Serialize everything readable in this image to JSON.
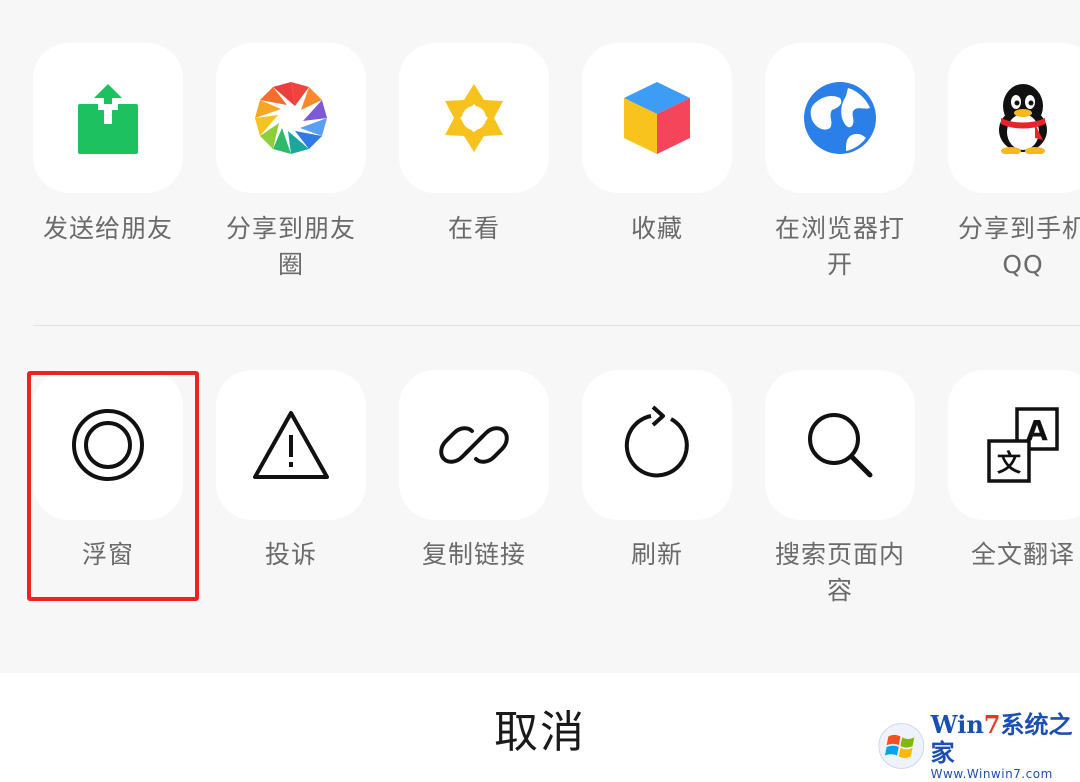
{
  "share_row": [
    {
      "label": "发送给朋友",
      "icon": "share-out-icon"
    },
    {
      "label": "分享到朋友圈",
      "icon": "moments-aperture-icon"
    },
    {
      "label": "在看",
      "icon": "wow-star-icon"
    },
    {
      "label": "收藏",
      "icon": "favorite-cube-icon"
    },
    {
      "label": "在浏览器打开",
      "icon": "globe-icon"
    },
    {
      "label": "分享到手机QQ",
      "icon": "qq-penguin-icon"
    }
  ],
  "action_row": [
    {
      "label": "浮窗",
      "icon": "float-window-icon"
    },
    {
      "label": "投诉",
      "icon": "warning-triangle-icon"
    },
    {
      "label": "复制链接",
      "icon": "link-icon"
    },
    {
      "label": "刷新",
      "icon": "refresh-icon"
    },
    {
      "label": "搜索页面内容",
      "icon": "search-icon"
    },
    {
      "label": "全文翻译",
      "icon": "translate-icon"
    }
  ],
  "cancel_label": "取消",
  "watermark": {
    "title_a": "Win",
    "title_b": "7",
    "title_c": "系统之家",
    "url": "Www.Winwin7.com"
  },
  "colors": {
    "sheet_bg": "#f7f7f7",
    "tile_bg": "#ffffff",
    "label_text": "#6a6a6a",
    "highlight": "#ee2222",
    "share_green": "#1ec15f"
  }
}
